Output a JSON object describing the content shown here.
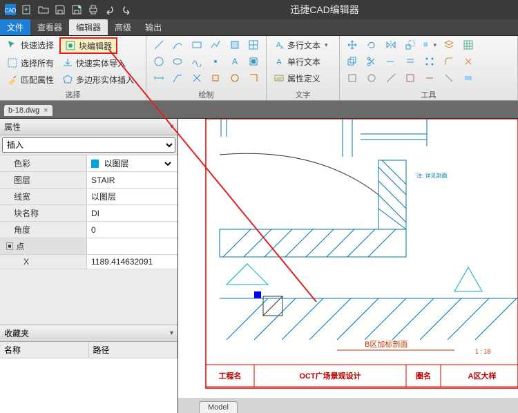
{
  "app": {
    "title": "迅捷CAD编辑器"
  },
  "qat": {
    "items": [
      "cad-logo",
      "new",
      "open",
      "save",
      "saveas",
      "print",
      "undo",
      "redo"
    ]
  },
  "menubar": {
    "file": "文件",
    "viewer": "查看器",
    "editor": "编辑器",
    "advanced": "高级",
    "output": "输出"
  },
  "ribbon": {
    "select": {
      "label": "选择",
      "quick_select": "快速选择",
      "select_all": "选择所有",
      "match_props": "匹配属性",
      "block_editor": "块编辑器",
      "quick_import": "快速实体导入",
      "poly_insert": "多边形实体插入"
    },
    "draw": {
      "label": "绘制"
    },
    "text": {
      "label": "文字",
      "mtext": "多行文本",
      "stext": "单行文本",
      "attdef": "属性定义"
    },
    "tools": {
      "label": "工具"
    }
  },
  "file_tab": {
    "name": "b-18.dwg"
  },
  "panel": {
    "props_title": "属性",
    "insert_combo": "插入",
    "rows": {
      "color": {
        "label": "色彩",
        "value": "以图层",
        "swatch": "#00a3e0"
      },
      "layer": {
        "label": "图层",
        "value": "STAIR"
      },
      "lineweight": {
        "label": "线宽",
        "value": "以图层"
      },
      "blockname": {
        "label": "块名称",
        "value": "DI"
      },
      "angle": {
        "label": "角度",
        "value": "0"
      },
      "group_point": "点",
      "x": {
        "label": "X",
        "value": "1189.414632091"
      }
    },
    "favorites": {
      "title": "收藏夹",
      "col_name": "名称",
      "col_path": "路径"
    }
  },
  "model_tab": "Model",
  "drawing": {
    "title_left_label": "工程名",
    "title_center": "OCT广场景观设计",
    "title_right_label": "圈名",
    "title_right_val": "A区大样",
    "section_label": "B区加标剖面",
    "scale": "1 : 18"
  }
}
